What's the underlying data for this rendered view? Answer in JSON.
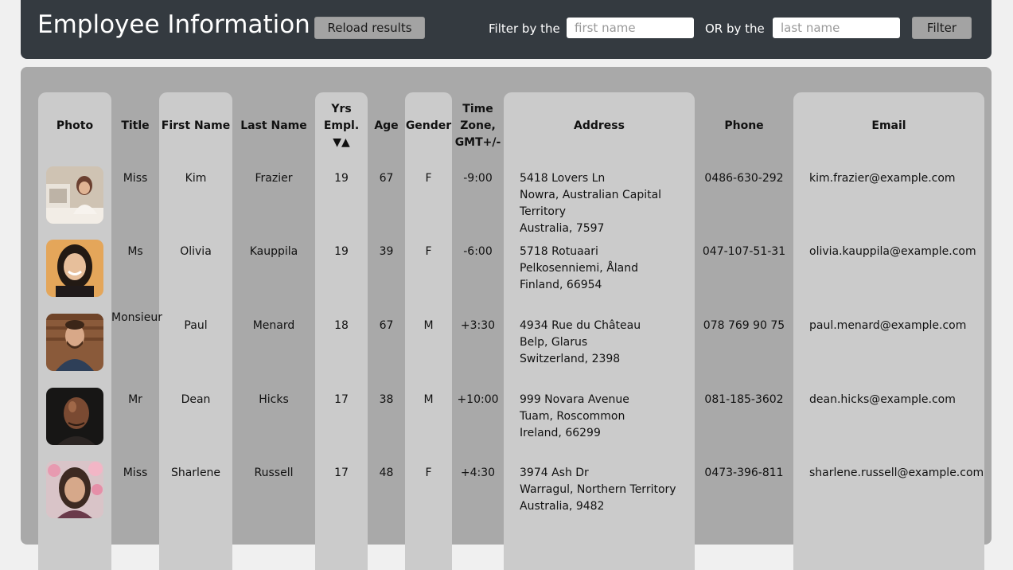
{
  "header": {
    "title": "Employee Information",
    "reload_label": "Reload results",
    "filter_first_label": "Filter by the",
    "first_placeholder": "first name",
    "filter_last_label": "OR by the",
    "last_placeholder": "last name",
    "filter_button": "Filter"
  },
  "table": {
    "columns": {
      "photo": "Photo",
      "title": "Title",
      "first": "First Name",
      "last": "Last Name",
      "yrs": "Yrs Empl. ▼▲",
      "age": "Age",
      "gender": "Gender",
      "tz": "Time Zone, GMT+/-",
      "address": "Address",
      "phone": "Phone",
      "email": "Email"
    },
    "rows": [
      {
        "title": "Miss",
        "first": "Kim",
        "last": "Frazier",
        "yrs": "19",
        "age": "67",
        "gender": "F",
        "tz": "-9:00",
        "addr1": "5418 Lovers Ln",
        "addr2": "Nowra, Australian Capital Territory",
        "addr3": "Australia, 7597",
        "phone": "0486-630-292",
        "email": "kim.frazier@example.com",
        "photo": "photo-of-woman-at-computer"
      },
      {
        "title": "Ms",
        "first": "Olivia",
        "last": "Kauppila",
        "yrs": "19",
        "age": "39",
        "gender": "F",
        "tz": "-6:00",
        "addr1": "5718 Rotuaari",
        "addr2": "Pelkosenniemi, Åland",
        "addr3": "Finland, 66954",
        "phone": "047-107-51-31",
        "email": "olivia.kauppila@example.com",
        "photo": "photo-of-smiling-woman"
      },
      {
        "title": "Monsieur",
        "first": "Paul",
        "last": "Menard",
        "yrs": "18",
        "age": "67",
        "gender": "M",
        "tz": "+3:30",
        "addr1": "4934 Rue du Château",
        "addr2": "Belp, Glarus",
        "addr3": "Switzerland, 2398",
        "phone": "078 769 90 75",
        "email": "paul.menard@example.com",
        "photo": "photo-of-bearded-man"
      },
      {
        "title": "Mr",
        "first": "Dean",
        "last": "Hicks",
        "yrs": "17",
        "age": "38",
        "gender": "M",
        "tz": "+10:00",
        "addr1": "999 Novara Avenue",
        "addr2": "Tuam, Roscommon",
        "addr3": "Ireland, 66299",
        "phone": "081-185-3602",
        "email": "dean.hicks@example.com",
        "photo": "photo-of-bald-man"
      },
      {
        "title": "Miss",
        "first": "Sharlene",
        "last": "Russell",
        "yrs": "17",
        "age": "48",
        "gender": "F",
        "tz": "+4:30",
        "addr1": "3974 Ash Dr",
        "addr2": "Warragul, Northern Territory",
        "addr3": "Australia, 9482",
        "phone": "0473-396-811",
        "email": "sharlene.russell@example.com",
        "photo": "photo-of-woman-with-blossoms"
      }
    ]
  }
}
